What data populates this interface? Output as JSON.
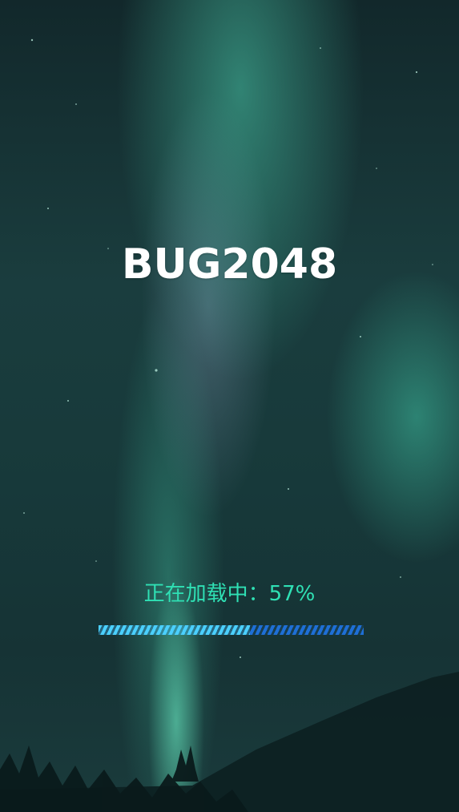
{
  "app": {
    "title": "BUG2048"
  },
  "loading": {
    "text": "正在加载中：57%",
    "progress_fraction": 0.57
  },
  "colors": {
    "title": "#ffffff",
    "loading_text": "#2fe0b4",
    "progress_fill": "#4bd0ff",
    "progress_track": "#1e6fd6"
  }
}
